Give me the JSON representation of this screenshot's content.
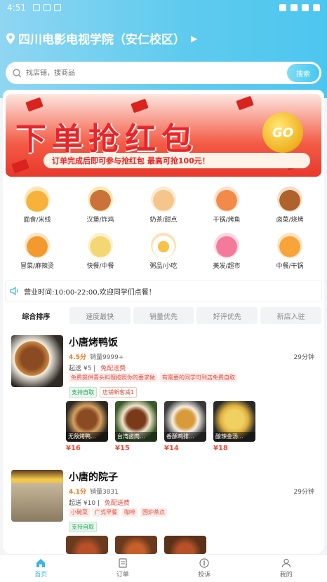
{
  "status_bar": {
    "time": "4:51"
  },
  "location": {
    "name": "四川电影电视学院（安仁校区）"
  },
  "search": {
    "placeholder": "找店铺，搜商品",
    "button": "搜索"
  },
  "banner": {
    "title": "下单抢红包",
    "subtitle": "订单完成后即可参与抢红包 最高可抢100元！",
    "badge": "GO"
  },
  "categories": [
    {
      "label": "面食/米线",
      "color": "#f6b23a"
    },
    {
      "label": "汉堡/炸鸡",
      "color": "#c9733a"
    },
    {
      "label": "奶茶/甜点",
      "color": "#f4c68b"
    },
    {
      "label": "干锅/烤鱼",
      "color": "#f28b4a"
    },
    {
      "label": "卤菜/烧烤",
      "color": "#b0622c"
    },
    {
      "label": "冒菜/麻辣烫",
      "color": "#f29a2e"
    },
    {
      "label": "快餐/中餐",
      "color": "#f5d675"
    },
    {
      "label": "粥品/小吃",
      "color": "#f7c34a"
    },
    {
      "label": "美发/超市",
      "color": "#f37a9a"
    },
    {
      "label": "中餐/干锅",
      "color": "#f7a43a"
    }
  ],
  "notice": {
    "text": "营业时间:10:00-22:00,欢迎同学们点餐！"
  },
  "sort_tabs": [
    "综合排序",
    "速度最快",
    "销量优先",
    "好评优先",
    "新店入驻"
  ],
  "shops": [
    {
      "name": "小唐烤鸭饭",
      "score": "4.5分",
      "sales": "销量9999+",
      "eta": "29分钟",
      "fee": "起送 ¥5",
      "free": "免配送费",
      "tags": [
        "免费提供青头料理按照你的要求做",
        "有需要的同学可到店免费自取"
      ],
      "promos": [
        "支持自取",
        "店铺新客减1"
      ],
      "dishes": [
        {
          "name": "无敌烤鸭...",
          "price": "¥16"
        },
        {
          "name": "台湾卤肉...",
          "price": "¥15"
        },
        {
          "name": "香酥鸡排...",
          "price": "¥14"
        },
        {
          "name": "酸辣金汤...",
          "price": "¥18"
        }
      ]
    },
    {
      "name": "小唐的院子",
      "score": "4.1分",
      "sales": "销量3831",
      "eta": "29分钟",
      "fee": "起送 ¥10",
      "free": "免配送费",
      "tags": [
        "小碗菜",
        "广式早餐",
        "咖啡",
        "国炉茶点"
      ],
      "promos": [
        "支持自取"
      ],
      "dishes": []
    }
  ],
  "tabbar": [
    {
      "label": "首页",
      "active": true
    },
    {
      "label": "订单"
    },
    {
      "label": "投诉"
    },
    {
      "label": "我的"
    }
  ]
}
